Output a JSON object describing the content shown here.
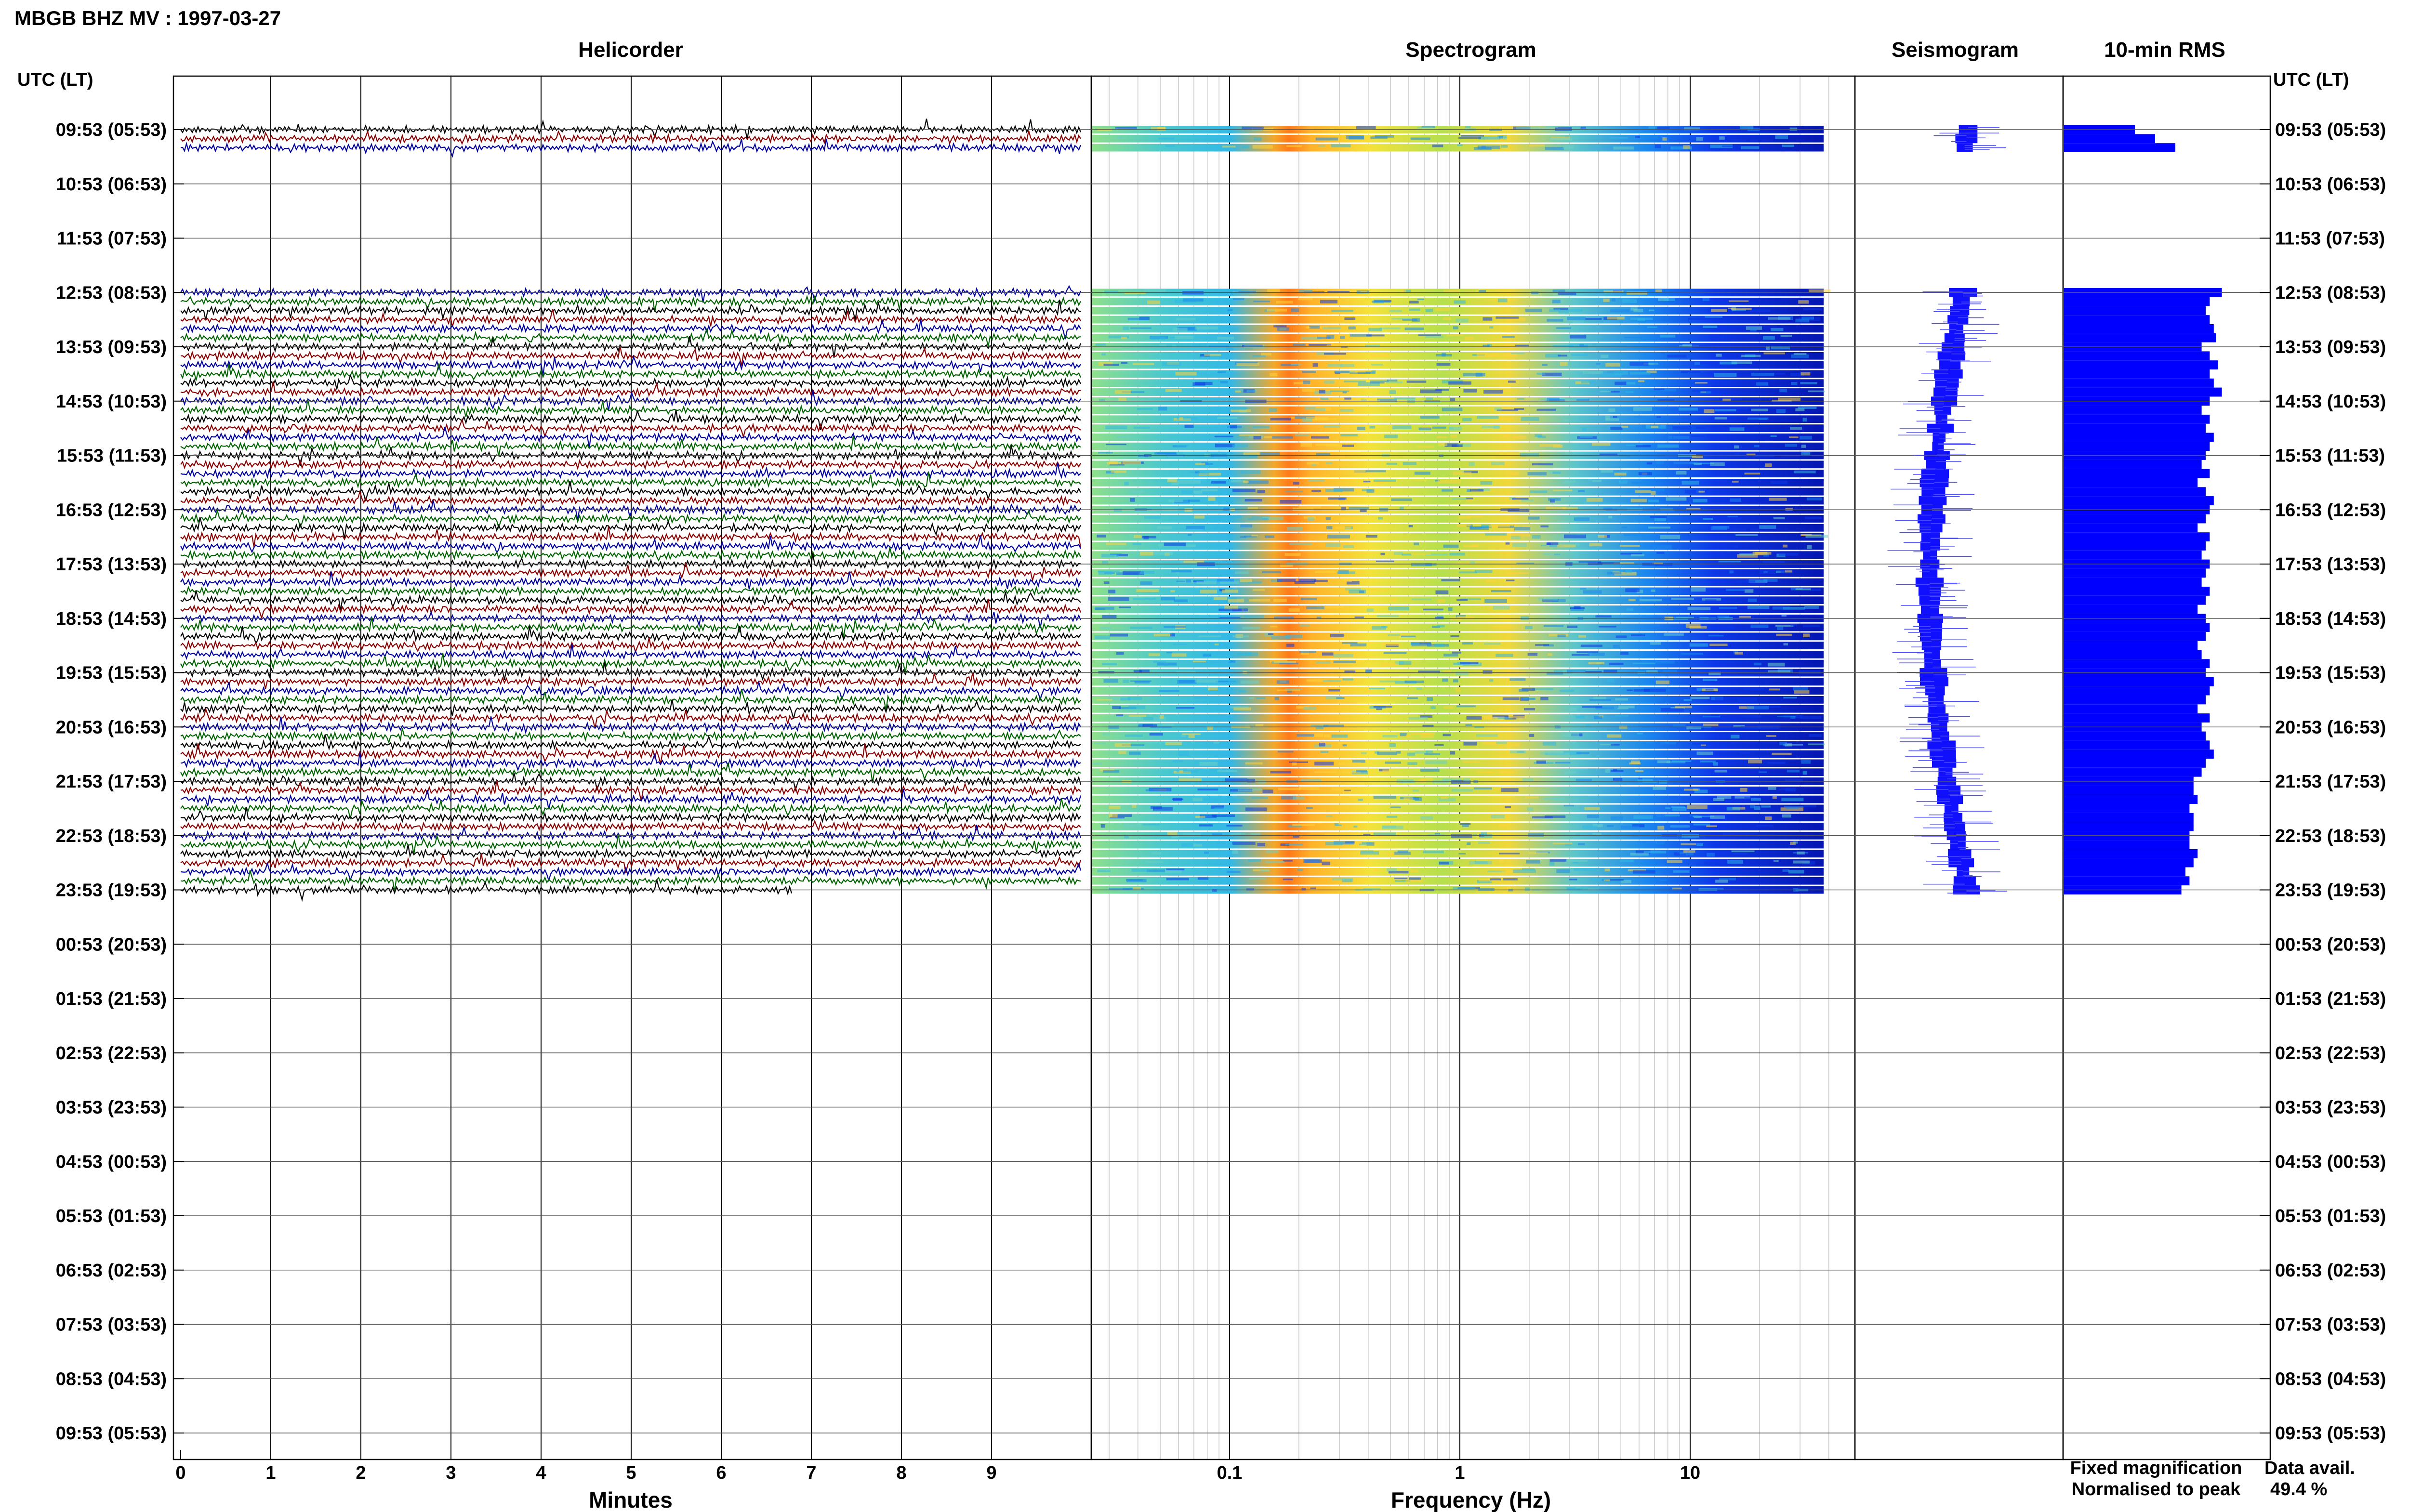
{
  "figure": {
    "title": "MBGB BHZ MV : 1997-03-27",
    "utc_header_left": "UTC (LT)",
    "utc_header_right": "UTC (LT)",
    "panel_titles": {
      "helicorder": "Helicorder",
      "spectrogram": "Spectrogram",
      "seismogram": "Seismogram",
      "rms": "10-min RMS"
    },
    "helicorder_xlabel": "Minutes",
    "spectrogram_xlabel": "Frequency (Hz)",
    "minute_ticks": [
      "0",
      "1",
      "2",
      "3",
      "4",
      "5",
      "6",
      "7",
      "8",
      "9"
    ],
    "freq_ticks": [
      "0.1",
      "1",
      "10"
    ],
    "hour_labels": [
      "09:53 (05:53)",
      "10:53 (06:53)",
      "11:53 (07:53)",
      "12:53 (08:53)",
      "13:53 (09:53)",
      "14:53 (10:53)",
      "15:53 (11:53)",
      "16:53 (12:53)",
      "17:53 (13:53)",
      "18:53 (14:53)",
      "19:53 (15:53)",
      "20:53 (16:53)",
      "21:53 (17:53)",
      "22:53 (18:53)",
      "23:53 (19:53)",
      "00:53 (20:53)",
      "01:53 (21:53)",
      "02:53 (22:53)",
      "03:53 (23:53)",
      "04:53 (00:53)",
      "05:53 (01:53)",
      "06:53 (02:53)",
      "07:53 (03:53)",
      "08:53 (04:53)",
      "09:53 (05:53)"
    ],
    "legend": {
      "fixed": "Fixed magnification",
      "normalised": "Normalised to peak",
      "fixed_color": "#1010ff",
      "normalised_color": "#ff1010"
    },
    "data_avail_label": "Data avail.",
    "data_avail_value": "49.4 %",
    "trace_colors": [
      "#000000",
      "#8b0000",
      "#0000a0",
      "#006400"
    ],
    "rms_color": "#0000ff"
  },
  "chart_data": {
    "type": "helicorder",
    "hours": 24,
    "rows_per_hour": 6,
    "row_minutes": 10,
    "data_rows": [
      {
        "hour_index": 0,
        "rows": [
          0,
          1,
          2
        ]
      },
      {
        "hour_index": 3,
        "rows": [
          0,
          1,
          2,
          3,
          4,
          5
        ]
      },
      {
        "hour_index": 4,
        "rows": [
          0,
          1,
          2,
          3,
          4,
          5
        ]
      },
      {
        "hour_index": 5,
        "rows": [
          0,
          1,
          2,
          3,
          4,
          5
        ]
      },
      {
        "hour_index": 6,
        "rows": [
          0,
          1,
          2,
          3,
          4,
          5
        ]
      },
      {
        "hour_index": 7,
        "rows": [
          0,
          1,
          2,
          3,
          4,
          5
        ]
      },
      {
        "hour_index": 8,
        "rows": [
          0,
          1,
          2,
          3,
          4,
          5
        ]
      },
      {
        "hour_index": 9,
        "rows": [
          0,
          1,
          2,
          3,
          4,
          5
        ]
      },
      {
        "hour_index": 10,
        "rows": [
          0,
          1,
          2,
          3,
          4,
          5
        ]
      },
      {
        "hour_index": 11,
        "rows": [
          0,
          1,
          2,
          3,
          4,
          5
        ]
      },
      {
        "hour_index": 12,
        "rows": [
          0,
          1,
          2,
          3,
          4,
          5
        ]
      },
      {
        "hour_index": 13,
        "rows": [
          0,
          1,
          2,
          3,
          4,
          5
        ]
      },
      {
        "hour_index": 14,
        "rows": [
          0
        ]
      }
    ],
    "last_row_end_minute": 6.8,
    "freq_range_hz": [
      0.03,
      40
    ],
    "freq_axis_scale": "log",
    "spectral_peak_hz": 0.2,
    "rms_values": [
      0.35,
      0.45,
      0.55,
      0.78,
      0.72,
      0.7,
      0.72,
      0.74,
      0.75,
      0.68,
      0.72,
      0.76,
      0.72,
      0.74,
      0.78,
      0.72,
      0.68,
      0.72,
      0.7,
      0.74,
      0.72,
      0.7,
      0.68,
      0.72,
      0.66,
      0.7,
      0.74,
      0.72,
      0.7,
      0.66,
      0.72,
      0.7,
      0.68,
      0.72,
      0.7,
      0.68,
      0.72,
      0.7,
      0.66,
      0.7,
      0.72,
      0.7,
      0.66,
      0.68,
      0.72,
      0.7,
      0.74,
      0.72,
      0.7,
      0.66,
      0.72,
      0.68,
      0.7,
      0.72,
      0.74,
      0.7,
      0.68,
      0.64,
      0.64,
      0.66,
      0.62,
      0.64,
      0.64,
      0.62,
      0.62,
      0.66,
      0.64,
      0.6,
      0.62,
      0.58,
      0.76
    ]
  }
}
